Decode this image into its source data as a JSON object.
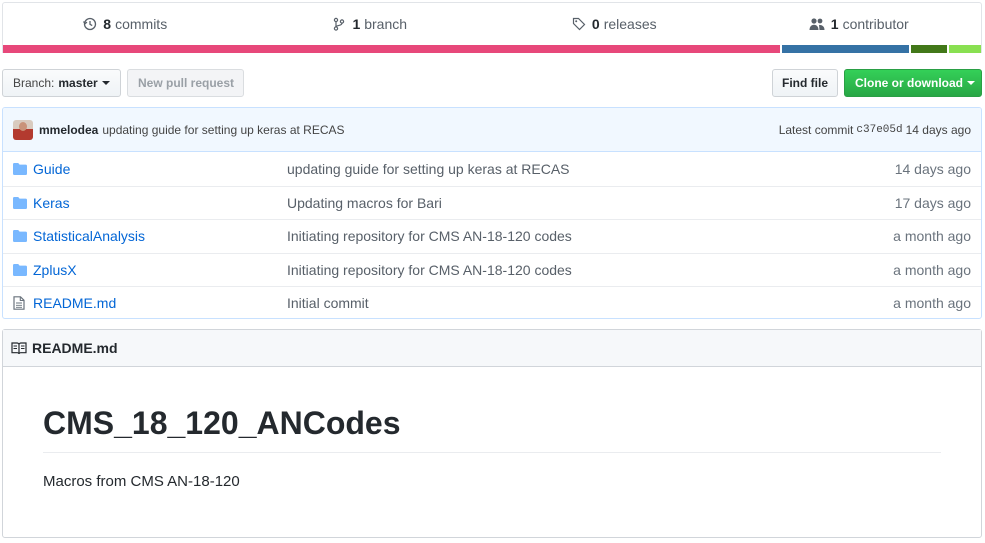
{
  "summary": {
    "commits": {
      "count": "8",
      "label": "commits"
    },
    "branches": {
      "count": "1",
      "label": "branch"
    },
    "releases": {
      "count": "0",
      "label": "releases"
    },
    "contributors": {
      "count": "1",
      "label": "contributor"
    }
  },
  "language_bar": [
    {
      "color": "#e7487a",
      "fraction": 0.797
    },
    {
      "color": "#3572a5",
      "fraction": 0.13
    },
    {
      "color": "#427819",
      "fraction": 0.037
    },
    {
      "color": "#89e051",
      "fraction": 0.033
    }
  ],
  "nav": {
    "branch_prefix": "Branch:",
    "branch_name": "master",
    "new_pull_request": "New pull request",
    "find_file": "Find file",
    "clone_download": "Clone or download"
  },
  "latest_commit": {
    "author": "mmelodea",
    "message": "updating guide for setting up keras at RECAS",
    "label": "Latest commit",
    "sha": "c37e05d",
    "age": "14 days ago"
  },
  "files": [
    {
      "type": "folder-icon",
      "name": "Guide",
      "message": "updating guide for setting up keras at RECAS",
      "age": "14 days ago"
    },
    {
      "type": "folder-icon",
      "name": "Keras",
      "message": "Updating macros for Bari",
      "age": "17 days ago"
    },
    {
      "type": "folder-icon",
      "name": "StatisticalAnalysis",
      "message": "Initiating repository for CMS AN-18-120 codes",
      "age": "a month ago"
    },
    {
      "type": "folder-icon",
      "name": "ZplusX",
      "message": "Initiating repository for CMS AN-18-120 codes",
      "age": "a month ago"
    },
    {
      "type": "file-icon",
      "name": "README.md",
      "message": "Initial commit",
      "age": "a month ago"
    }
  ],
  "readme": {
    "header": "README.md",
    "title": "CMS_18_120_ANCodes",
    "body": "Macros from CMS AN-18-120"
  }
}
